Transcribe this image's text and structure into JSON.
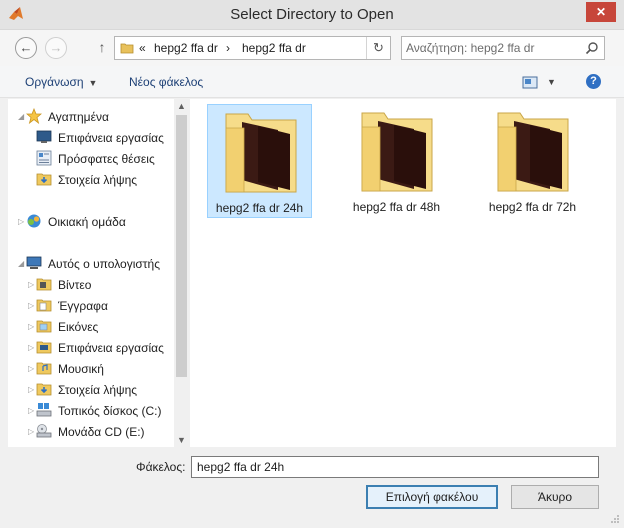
{
  "window": {
    "title": "Select Directory to Open",
    "close_label": "✕"
  },
  "navigation": {
    "breadcrumb": {
      "prefix": "«",
      "parts": [
        "hepg2 ffa dr",
        "hepg2 ffa dr"
      ],
      "separator": "›"
    },
    "search_placeholder": "Αναζήτηση: hepg2 ffa dr"
  },
  "toolbar": {
    "organize_label": "Οργάνωση",
    "new_folder_label": "Νέος φάκελος"
  },
  "tree": {
    "favorites": {
      "label": "Αγαπημένα",
      "items": [
        "Επιφάνεια εργασίας",
        "Πρόσφατες θέσεις",
        "Στοιχεία λήψης"
      ]
    },
    "homegroup": {
      "label": "Οικιακή ομάδα"
    },
    "computer": {
      "label": "Αυτός ο υπολογιστής",
      "items": [
        "Βίντεο",
        "Έγγραφα",
        "Εικόνες",
        "Επιφάνεια εργασίας",
        "Μουσική",
        "Στοιχεία λήψης",
        "Τοπικός δίσκος (C:)",
        "Μονάδα CD (E:)"
      ]
    }
  },
  "folders": [
    {
      "name": "hepg2 ffa dr 24h",
      "selected": true
    },
    {
      "name": "hepg2 ffa dr 48h",
      "selected": false
    },
    {
      "name": "hepg2 ffa dr 72h",
      "selected": false
    }
  ],
  "footer": {
    "folder_label": "Φάκελος:",
    "folder_value": "hepg2 ffa dr 24h",
    "select_button": "Επιλογή φακέλου",
    "cancel_button": "Άκυρο"
  },
  "colors": {
    "accent": "#3c7fb1",
    "selection": "#cce8ff",
    "link": "#1c3f75",
    "folder": "#f4d47a"
  }
}
